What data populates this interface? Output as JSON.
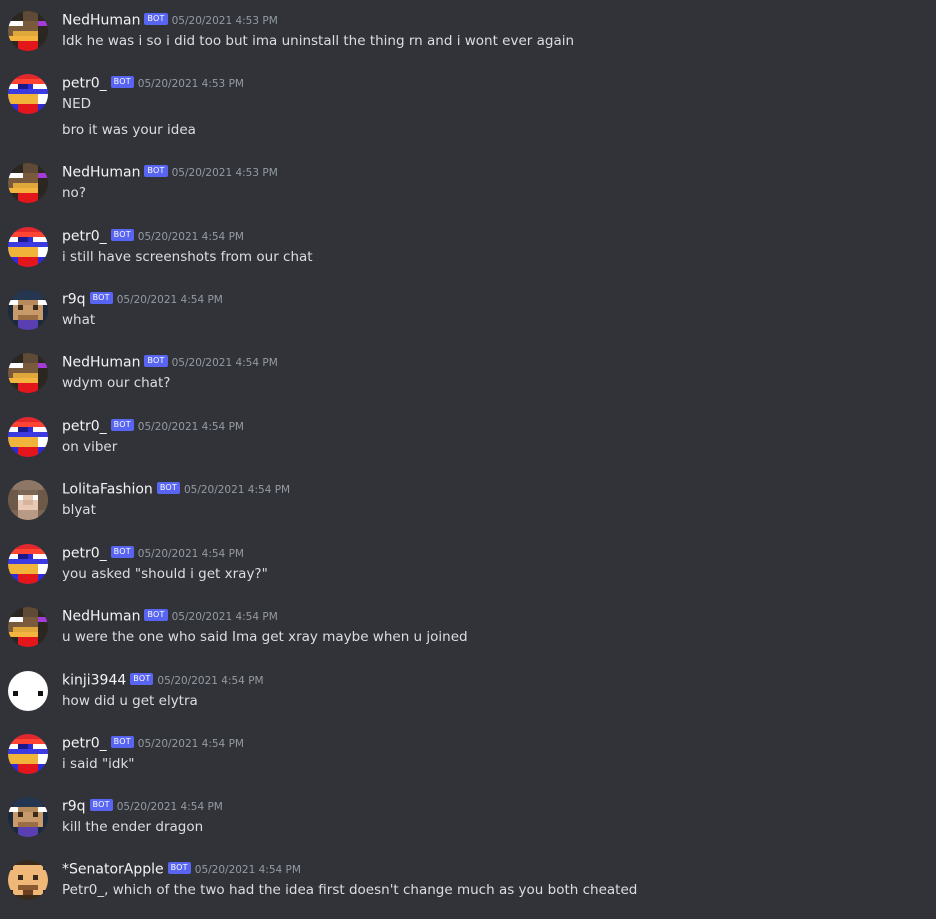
{
  "bot_tag": "BOT",
  "colors": {
    "background": "#313338",
    "username": "#f2f3f5",
    "text": "#dbdee1",
    "timestamp": "#949ba4",
    "bot_badge": "#5865f2"
  },
  "messages": [
    {
      "avatar": "nedhuman-avatar",
      "user": "NedHuman",
      "time": "05/20/2021 4:53 PM",
      "lines": [
        "Idk he was i so i did too but ima uninstall the thing rn and i wont ever again"
      ]
    },
    {
      "avatar": "petr0-avatar",
      "user": "petr0_",
      "time": "05/20/2021 4:53 PM",
      "lines": [
        "NED",
        "bro it was your idea"
      ]
    },
    {
      "avatar": "nedhuman-avatar",
      "user": "NedHuman",
      "time": "05/20/2021 4:53 PM",
      "lines": [
        "no?"
      ]
    },
    {
      "avatar": "petr0-avatar",
      "user": "petr0_",
      "time": "05/20/2021 4:54 PM",
      "lines": [
        "i still have screenshots from our chat"
      ]
    },
    {
      "avatar": "r9q-avatar",
      "user": "r9q",
      "time": "05/20/2021 4:54 PM",
      "lines": [
        "what"
      ]
    },
    {
      "avatar": "nedhuman-avatar",
      "user": "NedHuman",
      "time": "05/20/2021 4:54 PM",
      "lines": [
        "wdym our chat?"
      ]
    },
    {
      "avatar": "petr0-avatar",
      "user": "petr0_",
      "time": "05/20/2021 4:54 PM",
      "lines": [
        "on viber"
      ]
    },
    {
      "avatar": "lolitafashion-avatar",
      "user": "LolitaFashion",
      "time": "05/20/2021 4:54 PM",
      "lines": [
        "blyat"
      ]
    },
    {
      "avatar": "petr0-avatar",
      "user": "petr0_",
      "time": "05/20/2021 4:54 PM",
      "lines": [
        "you asked \"should i get xray?\""
      ]
    },
    {
      "avatar": "nedhuman-avatar",
      "user": "NedHuman",
      "time": "05/20/2021 4:54 PM",
      "lines": [
        "u were the one who said Ima get xray maybe when u joined"
      ]
    },
    {
      "avatar": "kinji3944-avatar",
      "user": "kinji3944",
      "time": "05/20/2021 4:54 PM",
      "lines": [
        "how did u get elytra"
      ]
    },
    {
      "avatar": "petr0-avatar",
      "user": "petr0_",
      "time": "05/20/2021 4:54 PM",
      "lines": [
        "i said \"idk\""
      ]
    },
    {
      "avatar": "r9q-avatar",
      "user": "r9q",
      "time": "05/20/2021 4:54 PM",
      "lines": [
        "kill the ender dragon"
      ]
    },
    {
      "avatar": "senatorapple-avatar",
      "user": "*SenatorApple",
      "time": "05/20/2021 4:54 PM",
      "lines": [
        "Petr0_, which of the two had the idea first doesn't change much as you both cheated"
      ]
    }
  ]
}
